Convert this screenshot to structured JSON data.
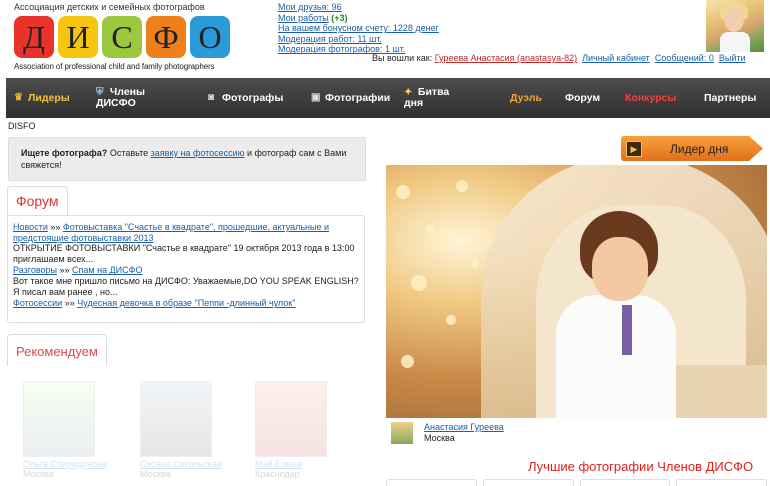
{
  "logo": {
    "tagline_top": "Ассоциация детских и семейных фотографов",
    "letters": [
      "Д",
      "И",
      "С",
      "Ф",
      "О"
    ],
    "tile_colors": [
      "#e8332a",
      "#f6c510",
      "#9bc83c",
      "#ee7f1a",
      "#2a9ad8"
    ],
    "tagline_bottom": "Association of professional child and family photographers"
  },
  "stats": {
    "friends": "Мои друзья: 96",
    "works_label": "Мои работы",
    "works_new": "(+3)",
    "bonus": "На вашем бонусном счету: 1228 денег",
    "works_moderation": "Модерация работ: 11 шт.",
    "photographers_moderation": "Модерация фотографов: 1 шт."
  },
  "user": {
    "logged_in_label": "Вы вошли как:",
    "name": "Гуреева Анастасия (anastasya-82)",
    "cabinet": "Личный кабинет",
    "messages": "Сообщений: 0",
    "logout": "Выйти"
  },
  "nav": {
    "leaders": "Лидеры",
    "members_1": "Члены",
    "members_2": "ДИСФО",
    "photographers": "Фотографы",
    "photos": "Фотографии",
    "battle_1": "Битва",
    "battle_2": "дня",
    "duel": "Дуэль",
    "forum": "Форум",
    "contests": "Конкурсы",
    "partners": "Партнеры"
  },
  "breadcrumb": "DISFO",
  "search_box": {
    "bold": "Ищете фотографа?",
    "before": " Оставьте ",
    "link": "заявку на фотосессию",
    "after": " и фотограф сам с Вами свяжется!"
  },
  "forum": {
    "tab": "Форум",
    "sep": " »» ",
    "items": [
      {
        "cat": "Новости",
        "topic": "Фотовыставка \"Счастье в квадрате\", прошедшие, актуальные и предстоящие фотовыставки 2013",
        "text": "ОТКРЫТИЕ ФОТОВЫСТАВКИ \"Счастье в квадрате\" 19 октября 2013 года в 13:00 приглашаем всех..."
      },
      {
        "cat": "Разговоры",
        "topic": "Спам на ДИСФО",
        "text": "Вот такое мне пришло письмо на ДИСФО: Уважаемые,DO YOU SPEAK ENGLISH? Я писал вам ранее , но..."
      },
      {
        "cat": "Фотосессии",
        "topic": "Чудесная девочка в образе \"Пеппи -длинный чулок\"",
        "text": ""
      }
    ]
  },
  "recommend": {
    "tab": "Рекомендуем",
    "cards": [
      {
        "name": "Ольга Спиридонова",
        "city": "Москва"
      },
      {
        "name": "Оксана Сокольская",
        "city": "Москва"
      },
      {
        "name": "Май Елена",
        "city": "Краснодар"
      }
    ]
  },
  "leader": {
    "button": "Лидер дня",
    "author": "Анастасия Гуреева",
    "city": "Москва"
  },
  "best_title": "Лучшие фотографии Членов ДИСФО"
}
